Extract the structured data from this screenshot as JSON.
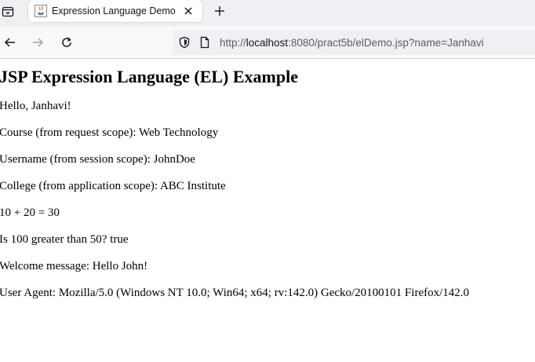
{
  "browser": {
    "tab": {
      "title": "Expression Language Demo",
      "favicon": "java-coffee-icon"
    },
    "url": {
      "scheme": "http://",
      "host": "localhost",
      "rest": ":8080/pract5b/elDemo.jsp?name=Janhavi"
    },
    "icons": {
      "tab_list": "tab-list-icon",
      "close": "close-icon",
      "new_tab": "plus-icon",
      "back": "back-arrow-icon",
      "forward": "forward-arrow-icon",
      "reload": "reload-icon",
      "shield": "tracking-shield-icon",
      "page": "page-info-icon"
    },
    "colors": {
      "chrome_bg": "#f0f0f4",
      "toolbar_bg": "#f9f9fb",
      "url_text": "#5b5b66",
      "url_host": "#15141a"
    }
  },
  "page": {
    "heading": "JSP Expression Language (EL) Example",
    "lines": [
      "Hello, Janhavi!",
      "Course (from request scope): Web Technology",
      "Username (from session scope): JohnDoe",
      "College (from application scope): ABC Institute",
      "10 + 20 = 30",
      "Is 100 greater than 50? true",
      "Welcome message: Hello John!",
      "User Agent: Mozilla/5.0 (Windows NT 10.0; Win64; x64; rv:142.0) Gecko/20100101 Firefox/142.0"
    ]
  }
}
